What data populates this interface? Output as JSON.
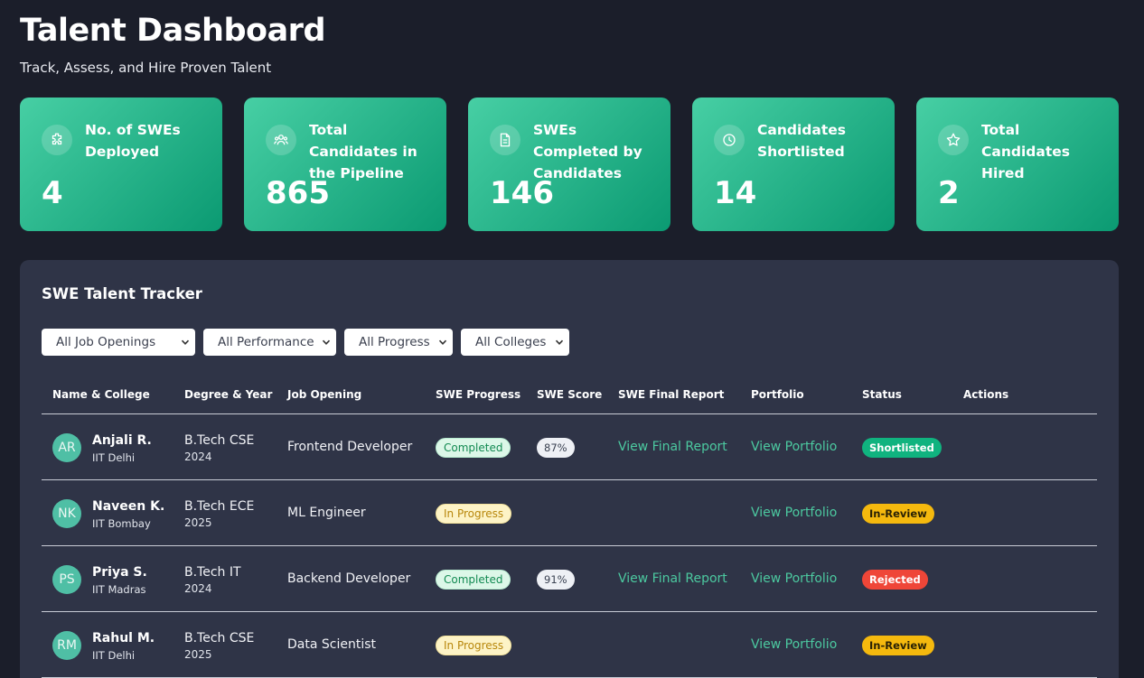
{
  "header": {
    "title": "Talent Dashboard",
    "subtitle": "Track, Assess, and Hire Proven Talent"
  },
  "stats": [
    {
      "label": "No. of SWEs Deployed",
      "value": "4",
      "icon": "puzzle-icon"
    },
    {
      "label": "Total Candidates in the Pipeline",
      "value": "865",
      "icon": "users-icon"
    },
    {
      "label": "SWEs Completed by Candidates",
      "value": "146",
      "icon": "document-icon"
    },
    {
      "label": "Candidates Shortlisted",
      "value": "14",
      "icon": "clock-icon"
    },
    {
      "label": "Total Candidates Hired",
      "value": "2",
      "icon": "star-icon"
    }
  ],
  "tracker": {
    "title": "SWE Talent Tracker",
    "filters": [
      {
        "selected": "All Job Openings"
      },
      {
        "selected": "All Performance"
      },
      {
        "selected": "All Progress"
      },
      {
        "selected": "All Colleges"
      }
    ],
    "columns": [
      "Name & College",
      "Degree & Year",
      "Job Opening",
      "SWE Progress",
      "SWE Score",
      "SWE Final Report",
      "Portfolio",
      "Status",
      "Actions"
    ],
    "rows": [
      {
        "initials": "AR",
        "name": "Anjali R.",
        "college": "IIT Delhi",
        "degree": "B.Tech CSE",
        "year": "2024",
        "job": "Frontend Developer",
        "progress": "Completed",
        "score": "87%",
        "report": "View Final Report",
        "portfolio": "View Portfolio",
        "status": "Shortlisted"
      },
      {
        "initials": "NK",
        "name": "Naveen K.",
        "college": "IIT Bombay",
        "degree": "B.Tech ECE",
        "year": "2025",
        "job": "ML Engineer",
        "progress": "In Progress",
        "score": "",
        "report": "",
        "portfolio": "View Portfolio",
        "status": "In-Review"
      },
      {
        "initials": "PS",
        "name": "Priya S.",
        "college": "IIT Madras",
        "degree": "B.Tech IT",
        "year": "2024",
        "job": "Backend Developer",
        "progress": "Completed",
        "score": "91%",
        "report": "View Final Report",
        "portfolio": "View Portfolio",
        "status": "Rejected"
      },
      {
        "initials": "RM",
        "name": "Rahul M.",
        "college": "IIT Delhi",
        "degree": "B.Tech CSE",
        "year": "2025",
        "job": "Data Scientist",
        "progress": "In Progress",
        "score": "",
        "report": "",
        "portfolio": "View Portfolio",
        "status": "In-Review"
      }
    ]
  },
  "colors": {
    "background": "#1b1e2a",
    "card_gradient_start": "#47cfa4",
    "card_gradient_end": "#0b9a72",
    "panel": "#2f3447",
    "link": "#4cc9a0",
    "status_shortlisted": "#10b37f",
    "status_in_review": "#f5b90e",
    "status_rejected": "#ef4638"
  }
}
